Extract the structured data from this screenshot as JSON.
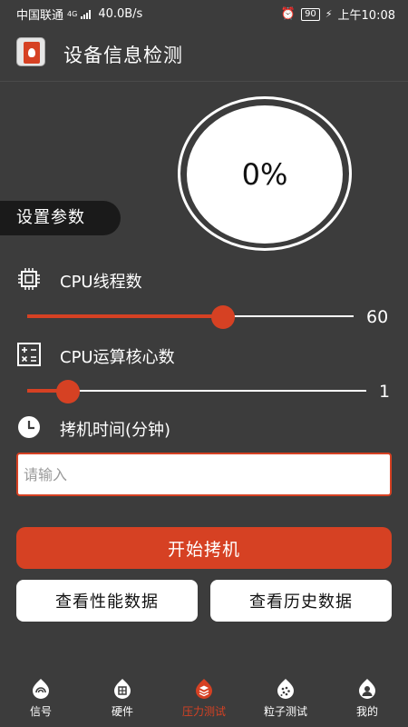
{
  "status_bar": {
    "carrier": "中国联通",
    "network": "4G",
    "speed": "40.0B/s",
    "battery": "90",
    "time": "上午10:08"
  },
  "app_bar": {
    "title": "设备信息检测"
  },
  "gauge": {
    "value_text": "0%"
  },
  "params_label": "设置参数",
  "cpu_threads": {
    "label": "CPU线程数",
    "value": "60",
    "fraction": 0.6
  },
  "cpu_cores": {
    "label": "CPU运算核心数",
    "value": "1",
    "fraction": 0.12
  },
  "burn_time": {
    "label": "拷机时间(分钟)",
    "placeholder": "请输入",
    "value": ""
  },
  "buttons": {
    "start": "开始拷机",
    "performance": "查看性能数据",
    "history": "查看历史数据"
  },
  "tabs": [
    {
      "label": "信号",
      "icon": "signal-icon",
      "active": false
    },
    {
      "label": "硬件",
      "icon": "hardware-icon",
      "active": false
    },
    {
      "label": "压力测试",
      "icon": "stress-test-icon",
      "active": true
    },
    {
      "label": "粒子测试",
      "icon": "particle-test-icon",
      "active": false
    },
    {
      "label": "我的",
      "icon": "profile-icon",
      "active": false
    }
  ],
  "colors": {
    "background": "#3c3c3c",
    "accent": "#d64123",
    "pill": "#1a1a1a"
  }
}
